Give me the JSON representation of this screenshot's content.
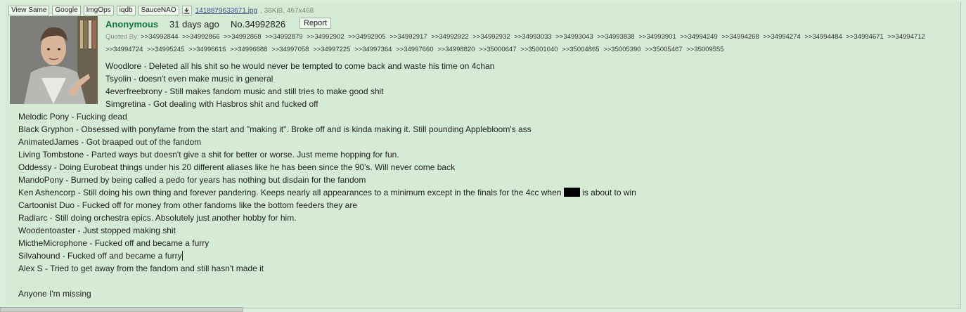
{
  "toolbar": {
    "buttons": [
      "View Same",
      "Google",
      "ImgOps",
      "iqdb",
      "SauceNAO"
    ],
    "download_icon": "download-icon",
    "filename": "1418879633671.jpg",
    "filemeta": ", 38KiB, 467x468"
  },
  "post": {
    "name": "Anonymous",
    "date": "31 days ago",
    "number": "No.34992826",
    "report_label": "Report",
    "quoted_label": "Quoted By:",
    "quoted_by": [
      ">>34992844",
      ">>34992866",
      ">>34992868",
      ">>34992879",
      ">>34992902",
      ">>34992905",
      ">>34992917",
      ">>34992922",
      ">>34992932",
      ">>34993033",
      ">>34993043",
      ">>34993838",
      ">>34993901",
      ">>34994249",
      ">>34994268",
      ">>34994274",
      ">>34994484",
      ">>34994671",
      ">>34994712",
      ">>34994724",
      ">>34995245",
      ">>34996616",
      ">>34996688",
      ">>34997058",
      ">>34997225",
      ">>34997364",
      ">>34997660",
      ">>34998820",
      ">>35000647",
      ">>35001040",
      ">>35004865",
      ">>35005390",
      ">>35005467",
      ">>35009555"
    ],
    "lines": [
      "Woodlore - Deleted all his shit so he would never be tempted to come back and waste his time on 4chan",
      "Tsyolin - doesn't even make music in general",
      "4everfreebrony - Still makes fandom music and still tries to make good shit",
      "Simgretina - Got dealing with Hasbros shit and fucked off",
      "Melodic Pony - Fucking dead",
      "Black Gryphon - Obsessed with ponyfame from the start and \"making it\". Broke off and is kinda making it. Still pounding Applebloom's ass",
      "AnimatedJames - Got braaped out of the fandom",
      "Living Tombstone - Parted ways but doesn't give a shit for better or worse. Just meme hopping for fun.",
      "Oddessy - Doing Eurobeat things under his 20 different aliases like he has been since the 90's. Will never come back",
      "MandoPony - Burned by being called a pedo for years has nothing but disdain for the fandom",
      "Ken Ashencorp - Still doing his own thing and forever pandering. Keeps nearly all appearances to a minimum except in the finals for the 4cc when",
      "Cartoonist Duo - Fucked off for money from other fandoms like the bottom feeders they are",
      "Radiarc - Still doing orchestra epics. Absolutely just another hobby for him.",
      "Woodentoaster - Just stopped making shit",
      "MictheMicrophone - Fucked off and became a furry",
      "Silvahound - Fucked off and became a furry",
      "Alex S - Tried to get away from the fandom and still hasn't made it",
      "Anyone I'm missing"
    ],
    "ken_suffix": "is about to win"
  }
}
